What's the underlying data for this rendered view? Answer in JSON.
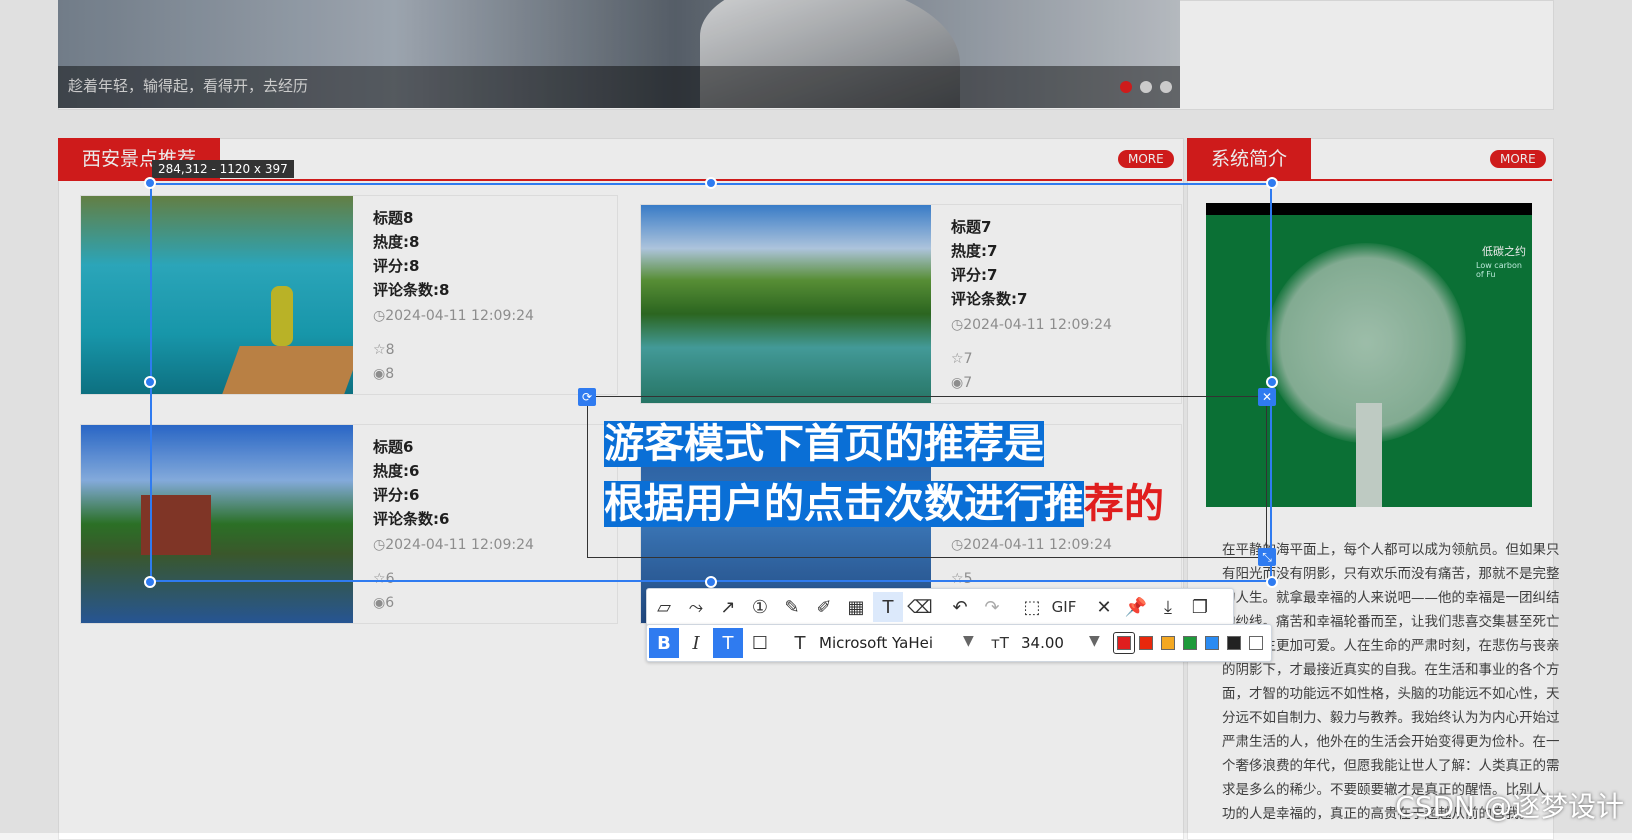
{
  "banner": {
    "caption": "趁着年轻，输得起，看得开，去经历"
  },
  "sections": {
    "left_title": "西安景点推荐",
    "right_title": "系统简介",
    "more": "MORE"
  },
  "cards": [
    {
      "title": "标题8",
      "heat": "热度:8",
      "score": "评分:8",
      "comments": "评论条数:8",
      "time": "2024-04-11 12:09:24",
      "stars": "8",
      "views": "8"
    },
    {
      "title": "标题7",
      "heat": "热度:7",
      "score": "评分:7",
      "comments": "评论条数:7",
      "time": "2024-04-11 12:09:24",
      "stars": "7",
      "views": "7"
    },
    {
      "title": "标题6",
      "heat": "热度:6",
      "score": "评分:6",
      "comments": "评论条数:6",
      "time": "2024-04-11 12:09:24",
      "stars": "6",
      "views": "6"
    },
    {
      "time": "2024-04-11 12:09:24",
      "stars": "5"
    }
  ],
  "intro": {
    "text": "在平静的海平面上，每个人都可以成为领航员。但如果只有阳光而没有阴影，只有欢乐而没有痛苦，那就不是完整的人生。就拿最幸福的人来说吧——他的幸福是一团纠结的纱线。痛苦和幸福轮番而至，让我们悲喜交集甚至死亡都让人生更加可爱。人在生命的严肃时刻，在悲伤与丧亲的阴影下，才最接近真实的自我。在生活和事业的各个方面，才智的功能远不如性格，头脑的功能远不如心性，天分远不如自制力、毅力与教养。我始终认为为内心开始过严肃生活的人，他外在的生活会开始变得更为俭朴。在一个奢侈浪费的年代，但愿我能让世人了解：人类真正的需求是多么的稀少。不要颐要辙才是真正的醒悟。比别人 功的人是幸福的，真正的高贵在于超越从前的自我。",
    "poster_title": "低碳之约",
    "poster_sub": "Low carbon of Fu"
  },
  "overlay": {
    "size_label": "284,312 - 1120 x 397",
    "text_line1": "游客模式下首页的推荐是",
    "text_line2_blue": "根据用户的点击次数进行推",
    "text_line2_red": "荐的",
    "font_name": "Microsoft YaHei",
    "font_size": "34.00",
    "gif_label": "GIF",
    "colors": [
      "#e01e1e",
      "#e8280c",
      "#f3a823",
      "#1e9a3a",
      "#2a8bf2",
      "#222222",
      "#ffffff"
    ]
  },
  "watermark": "CSDN @逐梦设计"
}
